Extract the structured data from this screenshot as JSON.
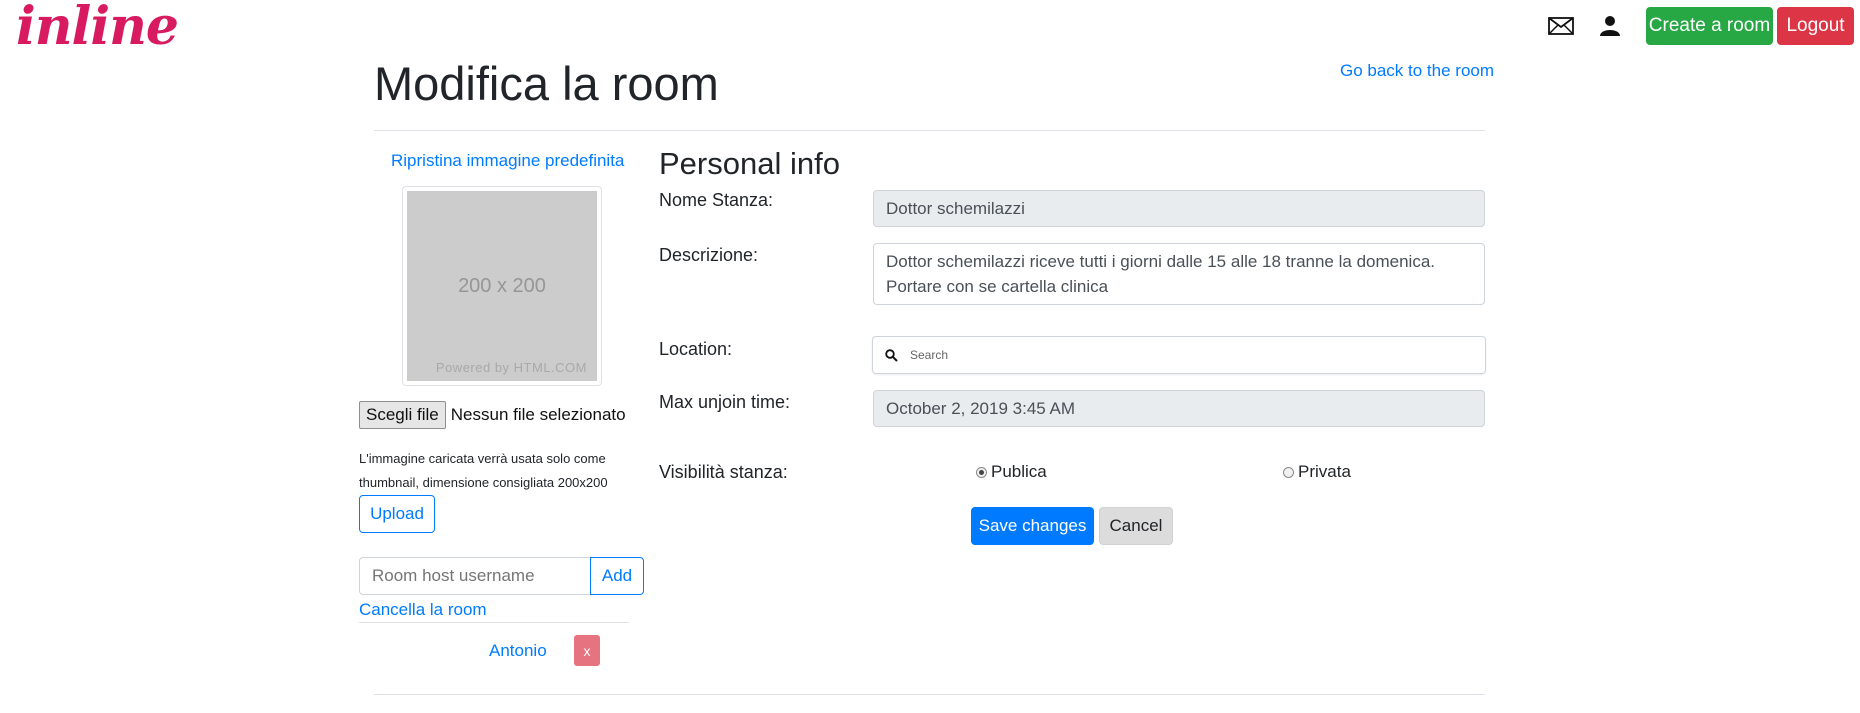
{
  "brand": {
    "logo_text": "inline"
  },
  "navbar": {
    "mail_icon": "envelope-icon",
    "user_icon": "user-icon",
    "create_room_label": "Create a room",
    "logout_label": "Logout"
  },
  "header": {
    "title": "Modifica la room",
    "back_link": "Go back to the room"
  },
  "left_panel": {
    "reset_image_link": "Ripristina immagine predefinita",
    "thumbnail": {
      "size_text": "200 x 200",
      "powered_text": "Powered by HTML.COM"
    },
    "file_input": {
      "button_label": "Scegli file",
      "status": "Nessun file selezionato"
    },
    "hint_text": "L'immagine caricata verrà usata solo come thumbnail, dimensione consigliata 200x200",
    "upload_label": "Upload",
    "host_input": {
      "placeholder": "Room host username",
      "value": ""
    },
    "add_label": "Add",
    "delete_room_link": "Cancella la room",
    "hosts": [
      {
        "name": "Antonio",
        "remove_label": "x"
      }
    ]
  },
  "form": {
    "section_title": "Personal info",
    "name": {
      "label": "Nome Stanza:",
      "value": "Dottor schemilazzi"
    },
    "description": {
      "label": "Descrizione:",
      "line1": "Dottor schemilazzi riceve tutti i giorni dalle 15 alle 18 tranne la domenica.",
      "line2": "Portare con se cartella clinica"
    },
    "location": {
      "label": "Location:",
      "placeholder": "Search",
      "search_icon": "search-icon"
    },
    "max_unjoin": {
      "label": "Max unjoin time:",
      "value": "October 2, 2019 3:45 AM"
    },
    "visibility": {
      "label": "Visibilità stanza:",
      "options": [
        {
          "label": "Publica",
          "selected": true
        },
        {
          "label": "Privata",
          "selected": false
        }
      ]
    },
    "save_label": "Save changes",
    "cancel_label": "Cancel"
  },
  "colors": {
    "brand": "#d81b60",
    "primary": "#007bff",
    "success": "#28a745",
    "danger": "#dc3545",
    "readonly_bg": "#e9ecef"
  }
}
